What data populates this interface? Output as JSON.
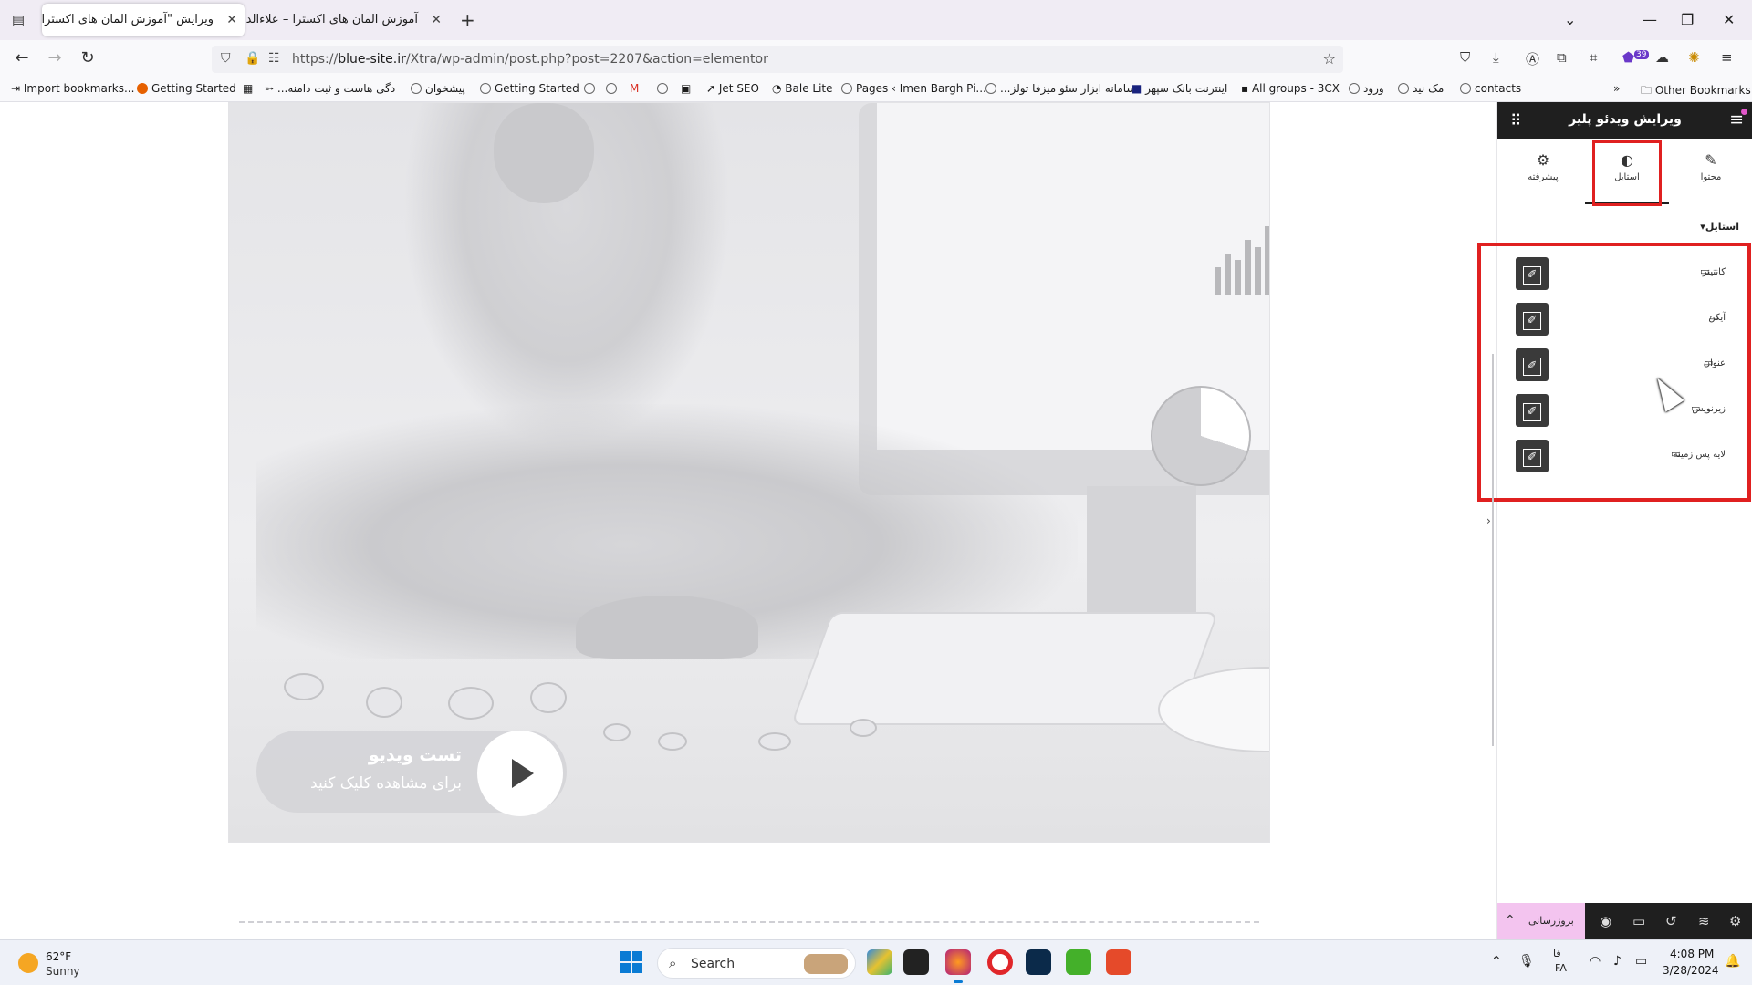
{
  "browser": {
    "tabs": [
      {
        "title": "ویرایش \"آموزش المان های اکسترا – ع",
        "active": true
      },
      {
        "title": "آموزش المان های اکسترا – علاءالدین",
        "active": false
      }
    ],
    "url_prefix": "https://",
    "url_domain": "blue-site.ir",
    "url_path": "/Xtra/wp-admin/post.php?post=2207&action=elementor",
    "notification_count": "39",
    "bookmarks": [
      "Import bookmarks...",
      "Getting Started",
      "...دگی هاست و ثبت دامنه",
      "پیشخوان",
      "Getting Started",
      "Jet SEO",
      "Bale Lite",
      "Pages ‹ Imen Bargh Pi...",
      "...سامانه ابزار سئو میزفا تولز",
      "اینترنت بانک سپهر",
      "All groups - 3CX",
      "ورود",
      "مک نید",
      "contacts",
      "Other Bookmarks"
    ]
  },
  "video": {
    "title": "تست ویدیو",
    "subtitle": "برای مشاهده کلیک کنید"
  },
  "panel": {
    "title": "ویرایش ویدئو پلیر",
    "tabs": [
      {
        "label": "محتوا",
        "icon": "pencil-icon"
      },
      {
        "label": "استایل",
        "icon": "contrast-icon",
        "active": true
      },
      {
        "label": "پیشرفته",
        "icon": "gear-icon"
      }
    ],
    "section_title": "استایل",
    "controls": [
      {
        "label": "کانتینر"
      },
      {
        "label": "آیکن"
      },
      {
        "label": "عنوان"
      },
      {
        "label": "زیرنویس"
      },
      {
        "label": "لایه پس زمینه"
      }
    ],
    "footer_update_label": "بروزرسانی"
  },
  "taskbar": {
    "weather_temp": "62°F",
    "weather_condition": "Sunny",
    "search_placeholder": "Search",
    "lang_top": "فا",
    "lang_bottom": "FA",
    "time": "4:08 PM",
    "date": "3/28/2024"
  },
  "colors": {
    "highlight": "#e02020",
    "panel_dark": "#1f1f1f",
    "update_pink": "#f3c4ef"
  }
}
